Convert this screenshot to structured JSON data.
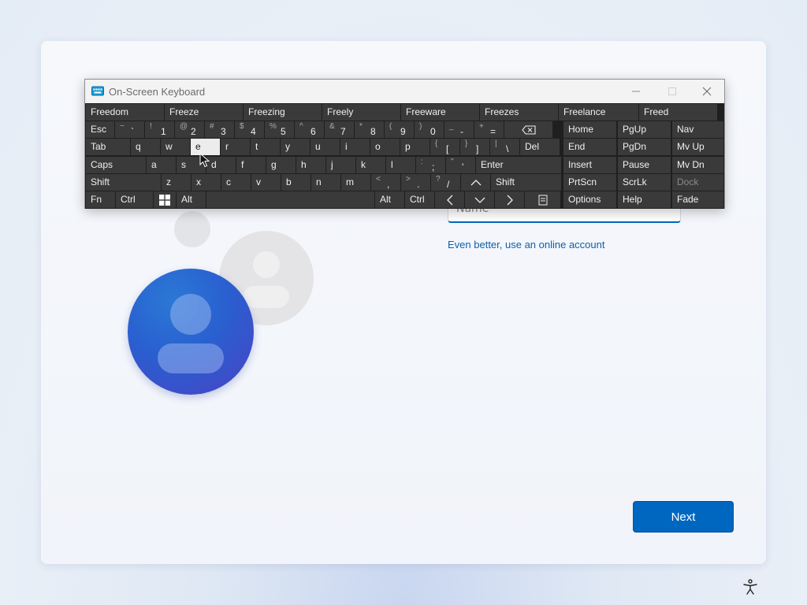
{
  "osk": {
    "title": "On-Screen Keyboard",
    "predictions": [
      "Freedom",
      "Freeze",
      "Freezing",
      "Freely",
      "Freeware",
      "Freezes",
      "Freelance",
      "Freed"
    ],
    "row1": [
      {
        "label": "Esc"
      },
      {
        "shift": "~",
        "main": "`"
      },
      {
        "shift": "!",
        "main": "1"
      },
      {
        "shift": "@",
        "main": "2"
      },
      {
        "shift": "#",
        "main": "3"
      },
      {
        "shift": "$",
        "main": "4"
      },
      {
        "shift": "%",
        "main": "5"
      },
      {
        "shift": "^",
        "main": "6"
      },
      {
        "shift": "&",
        "main": "7"
      },
      {
        "shift": "*",
        "main": "8"
      },
      {
        "shift": "(",
        "main": "9"
      },
      {
        "shift": ")",
        "main": "0"
      },
      {
        "shift": "_",
        "main": "-"
      },
      {
        "shift": "+",
        "main": "="
      },
      {
        "icon": "backspace-icon"
      }
    ],
    "row2": [
      "Tab",
      "q",
      "w",
      "e",
      "r",
      "t",
      "y",
      "u",
      "i",
      "o",
      "p"
    ],
    "row2_extra": [
      {
        "shift": "{",
        "main": "["
      },
      {
        "shift": "}",
        "main": "]"
      },
      {
        "shift": "|",
        "main": "\\"
      },
      {
        "label": "Del"
      }
    ],
    "row3": [
      "Caps",
      "a",
      "s",
      "d",
      "f",
      "g",
      "h",
      "j",
      "k",
      "l"
    ],
    "row3_extra": [
      {
        "shift": ":",
        "main": ";"
      },
      {
        "shift": "\"",
        "main": "'"
      },
      {
        "label": "Enter"
      }
    ],
    "row4": [
      "Shift",
      "z",
      "x",
      "c",
      "v",
      "b",
      "n",
      "m"
    ],
    "row4_extra": [
      {
        "shift": "<",
        "main": ","
      },
      {
        "shift": ">",
        "main": "."
      },
      {
        "shift": "?",
        "main": "/"
      },
      {
        "icon": "arrow-up-icon"
      },
      {
        "label": "Shift"
      }
    ],
    "row5": {
      "fn": "Fn",
      "ctrl": "Ctrl",
      "win_icon": "windows-icon",
      "alt": "Alt",
      "alt_r": "Alt",
      "ctrl_r": "Ctrl",
      "menu_icon": "menu-icon"
    },
    "nav": {
      "home": "Home",
      "pgup": "PgUp",
      "nav": "Nav",
      "end": "End",
      "pgdn": "PgDn",
      "mvup": "Mv Up",
      "insert": "Insert",
      "pause": "Pause",
      "mvdn": "Mv Dn",
      "prtscn": "PrtScn",
      "scrlk": "ScrLk",
      "dock": "Dock",
      "options": "Options",
      "help": "Help",
      "fade": "Fade"
    },
    "highlighted_key": "e"
  },
  "form": {
    "name_placeholder": "Name",
    "online_link": "Even better, use an online account",
    "next_label": "Next"
  },
  "colors": {
    "accent": "#0067c0",
    "key_bg": "#3a3a3a",
    "keyboard_bg": "#1f1f1f"
  }
}
